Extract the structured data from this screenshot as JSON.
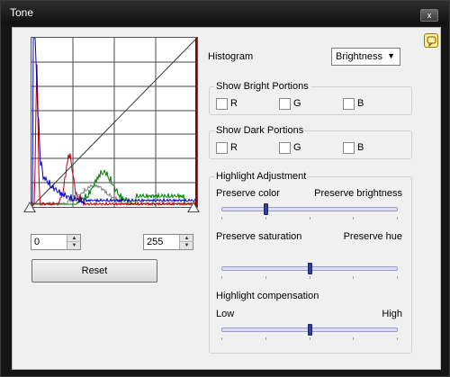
{
  "window": {
    "title": "Tone",
    "close_glyph": "x"
  },
  "help_icon": "help-icon",
  "histogram": {
    "left_value": "0",
    "right_value": "255",
    "spin_up": "▲",
    "spin_down": "▼",
    "reset_label": "Reset",
    "colors": {
      "red": "#c00000",
      "green": "#008000",
      "blue": "#0000c8",
      "gray": "#808080",
      "grid": "#4a4a4a",
      "frame_right": "#8b0000"
    }
  },
  "controls": {
    "histogram_label": "Histogram",
    "histogram_mode": "Brightness",
    "dropdown_arrow": "▼",
    "show_bright": {
      "title": "Show Bright Portions",
      "r": "R",
      "g": "G",
      "b": "B"
    },
    "show_dark": {
      "title": "Show Dark Portions",
      "r": "R",
      "g": "G",
      "b": "B"
    },
    "highlight": {
      "title": "Highlight Adjustment",
      "s1_left": "Preserve color",
      "s1_right": "Preserve brightness",
      "s1_value": 0.25,
      "s2_left": "Preserve saturation",
      "s2_right": "Preserve hue",
      "s2_value": 0.5,
      "comp_title": "Highlight compensation",
      "s3_left": "Low",
      "s3_right": "High",
      "s3_value": 0.5
    }
  }
}
